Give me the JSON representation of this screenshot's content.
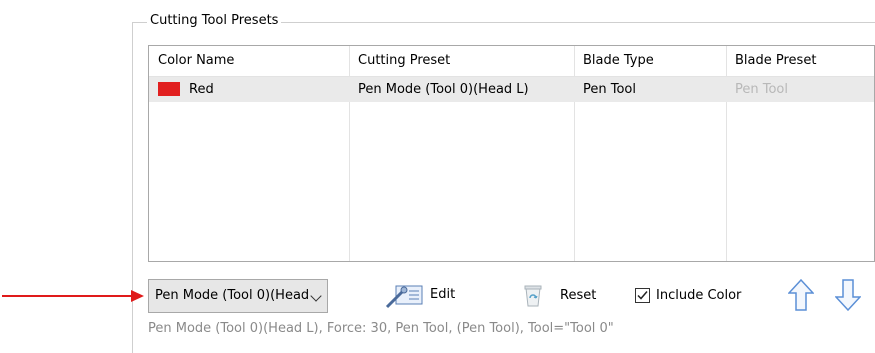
{
  "group": {
    "title": "Cutting Tool Presets"
  },
  "table": {
    "headers": [
      "Color Name",
      "Cutting Preset",
      "Blade Type",
      "Blade Preset"
    ],
    "rows": [
      {
        "color_name": "Red",
        "color_hex": "#e11f1f",
        "cutting_preset": "Pen Mode (Tool 0)(Head L)",
        "blade_type": "Pen Tool",
        "blade_preset": "Pen Tool"
      }
    ]
  },
  "toolbar": {
    "preset_select": "Pen Mode (Tool 0)(Head",
    "edit_label": "Edit",
    "reset_label": "Reset",
    "include_color_label": "Include Color",
    "include_color_checked": true
  },
  "status_text": "Pen Mode (Tool 0)(Head L), Force: 30, Pen Tool, (Pen Tool), Tool=\"Tool 0\"",
  "colors": {
    "annotation_arrow": "#e01a1a",
    "move_arrow": "#5b8fd6"
  }
}
